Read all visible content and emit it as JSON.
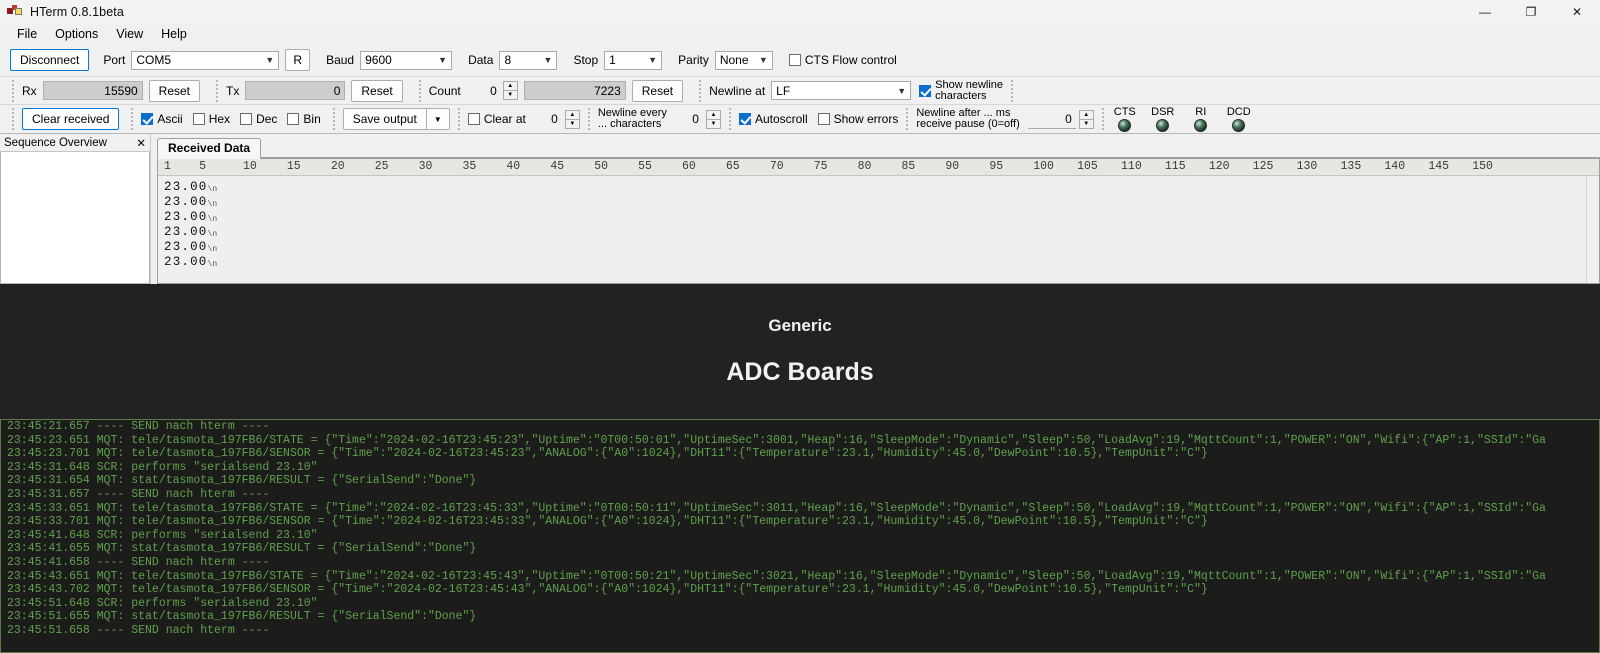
{
  "window": {
    "title": "HTerm 0.8.1beta",
    "minimize": "—",
    "maximize": "❐",
    "close": "✕"
  },
  "menu": [
    "File",
    "Options",
    "View",
    "Help"
  ],
  "toolbar_row1": {
    "disconnect_label": "Disconnect",
    "port_label": "Port",
    "port_value": "COM5",
    "rescan_label": "R",
    "baud_label": "Baud",
    "baud_value": "9600",
    "data_label": "Data",
    "data_value": "8",
    "stop_label": "Stop",
    "stop_value": "1",
    "parity_label": "Parity",
    "parity_value": "None",
    "cts_flow_label": "CTS Flow control",
    "cts_flow_checked": false
  },
  "toolbar_row2": {
    "rx_label": "Rx",
    "rx_value": "15590",
    "rx_reset": "Reset",
    "tx_label": "Tx",
    "tx_value": "0",
    "tx_reset": "Reset",
    "count_label": "Count",
    "count_value": "0",
    "count_total": "7223",
    "count_reset": "Reset",
    "newline_at_label": "Newline at",
    "newline_at_value": "LF",
    "show_newline_label_1": "Show newline",
    "show_newline_label_2": "characters",
    "show_newline_checked": true
  },
  "toolbar_row3": {
    "clear_received_label": "Clear received",
    "ascii_label": "Ascii",
    "ascii_checked": true,
    "hex_label": "Hex",
    "hex_checked": false,
    "dec_label": "Dec",
    "dec_checked": false,
    "bin_label": "Bin",
    "bin_checked": false,
    "save_output_label": "Save output",
    "clear_at_label": "Clear at",
    "clear_at_checked": false,
    "clear_at_value": "0",
    "newline_every_label_1": "Newline every",
    "newline_every_label_2": "... characters",
    "newline_every_value": "0",
    "autoscroll_label": "Autoscroll",
    "autoscroll_checked": true,
    "show_errors_label": "Show errors",
    "show_errors_checked": false,
    "newline_after_label_1": "Newline after ... ms",
    "newline_after_label_2": "receive pause (0=off)",
    "newline_after_value": "0",
    "leds": [
      {
        "name": "CTS",
        "state": "off"
      },
      {
        "name": "DSR",
        "state": "off"
      },
      {
        "name": "RI",
        "state": "off"
      },
      {
        "name": "DCD",
        "state": "off"
      }
    ]
  },
  "sequence_panel": {
    "title": "Sequence Overview",
    "close_label": "✕"
  },
  "received": {
    "tab_label": "Received Data",
    "ruler_ticks": [
      "1",
      "5",
      "10",
      "15",
      "20",
      "25",
      "30",
      "35",
      "40",
      "45",
      "50",
      "55",
      "60",
      "65",
      "70",
      "75",
      "80",
      "85",
      "90",
      "95",
      "100",
      "105",
      "110",
      "115",
      "120",
      "125",
      "130",
      "135",
      "140",
      "145",
      "150"
    ],
    "newline_glyph": "\\n",
    "lines": [
      "23.00",
      "23.00",
      "23.00",
      "23.00",
      "23.00",
      "23.00"
    ]
  },
  "banner": {
    "line1": "Generic",
    "line2": "ADC Boards",
    "bg_color": "#222222",
    "text_color": "#f2f2f2"
  },
  "console": {
    "text_color": "#5fa04e",
    "bg_color": "#1c1d1a",
    "lines": [
      "23:45:21.657 ---- SEND nach hterm ----",
      "23:45:23.651 MQT: tele/tasmota_197FB6/STATE = {\"Time\":\"2024-02-16T23:45:23\",\"Uptime\":\"0T00:50:01\",\"UptimeSec\":3001,\"Heap\":16,\"SleepMode\":\"Dynamic\",\"Sleep\":50,\"LoadAvg\":19,\"MqttCount\":1,\"POWER\":\"ON\",\"Wifi\":{\"AP\":1,\"SSId\":\"Ga",
      "23:45:23.701 MQT: tele/tasmota_197FB6/SENSOR = {\"Time\":\"2024-02-16T23:45:23\",\"ANALOG\":{\"A0\":1024},\"DHT11\":{\"Temperature\":23.1,\"Humidity\":45.0,\"DewPoint\":10.5},\"TempUnit\":\"C\"}",
      "23:45:31.648 SCR: performs \"serialsend 23.10\"",
      "23:45:31.654 MQT: stat/tasmota_197FB6/RESULT = {\"SerialSend\":\"Done\"}",
      "23:45:31.657 ---- SEND nach hterm ----",
      "23:45:33.651 MQT: tele/tasmota_197FB6/STATE = {\"Time\":\"2024-02-16T23:45:33\",\"Uptime\":\"0T00:50:11\",\"UptimeSec\":3011,\"Heap\":16,\"SleepMode\":\"Dynamic\",\"Sleep\":50,\"LoadAvg\":19,\"MqttCount\":1,\"POWER\":\"ON\",\"Wifi\":{\"AP\":1,\"SSId\":\"Ga",
      "23:45:33.701 MQT: tele/tasmota_197FB6/SENSOR = {\"Time\":\"2024-02-16T23:45:33\",\"ANALOG\":{\"A0\":1024},\"DHT11\":{\"Temperature\":23.1,\"Humidity\":45.0,\"DewPoint\":10.5},\"TempUnit\":\"C\"}",
      "23:45:41.648 SCR: performs \"serialsend 23.10\"",
      "23:45:41.655 MQT: stat/tasmota_197FB6/RESULT = {\"SerialSend\":\"Done\"}",
      "23:45:41.658 ---- SEND nach hterm ----",
      "23:45:43.651 MQT: tele/tasmota_197FB6/STATE = {\"Time\":\"2024-02-16T23:45:43\",\"Uptime\":\"0T00:50:21\",\"UptimeSec\":3021,\"Heap\":16,\"SleepMode\":\"Dynamic\",\"Sleep\":50,\"LoadAvg\":19,\"MqttCount\":1,\"POWER\":\"ON\",\"Wifi\":{\"AP\":1,\"SSId\":\"Ga",
      "23:45:43.702 MQT: tele/tasmota_197FB6/SENSOR = {\"Time\":\"2024-02-16T23:45:43\",\"ANALOG\":{\"A0\":1024},\"DHT11\":{\"Temperature\":23.1,\"Humidity\":45.0,\"DewPoint\":10.5},\"TempUnit\":\"C\"}",
      "23:45:51.648 SCR: performs \"serialsend 23.10\"",
      "23:45:51.655 MQT: stat/tasmota_197FB6/RESULT = {\"SerialSend\":\"Done\"}",
      "23:45:51.658 ---- SEND nach hterm ----"
    ]
  }
}
